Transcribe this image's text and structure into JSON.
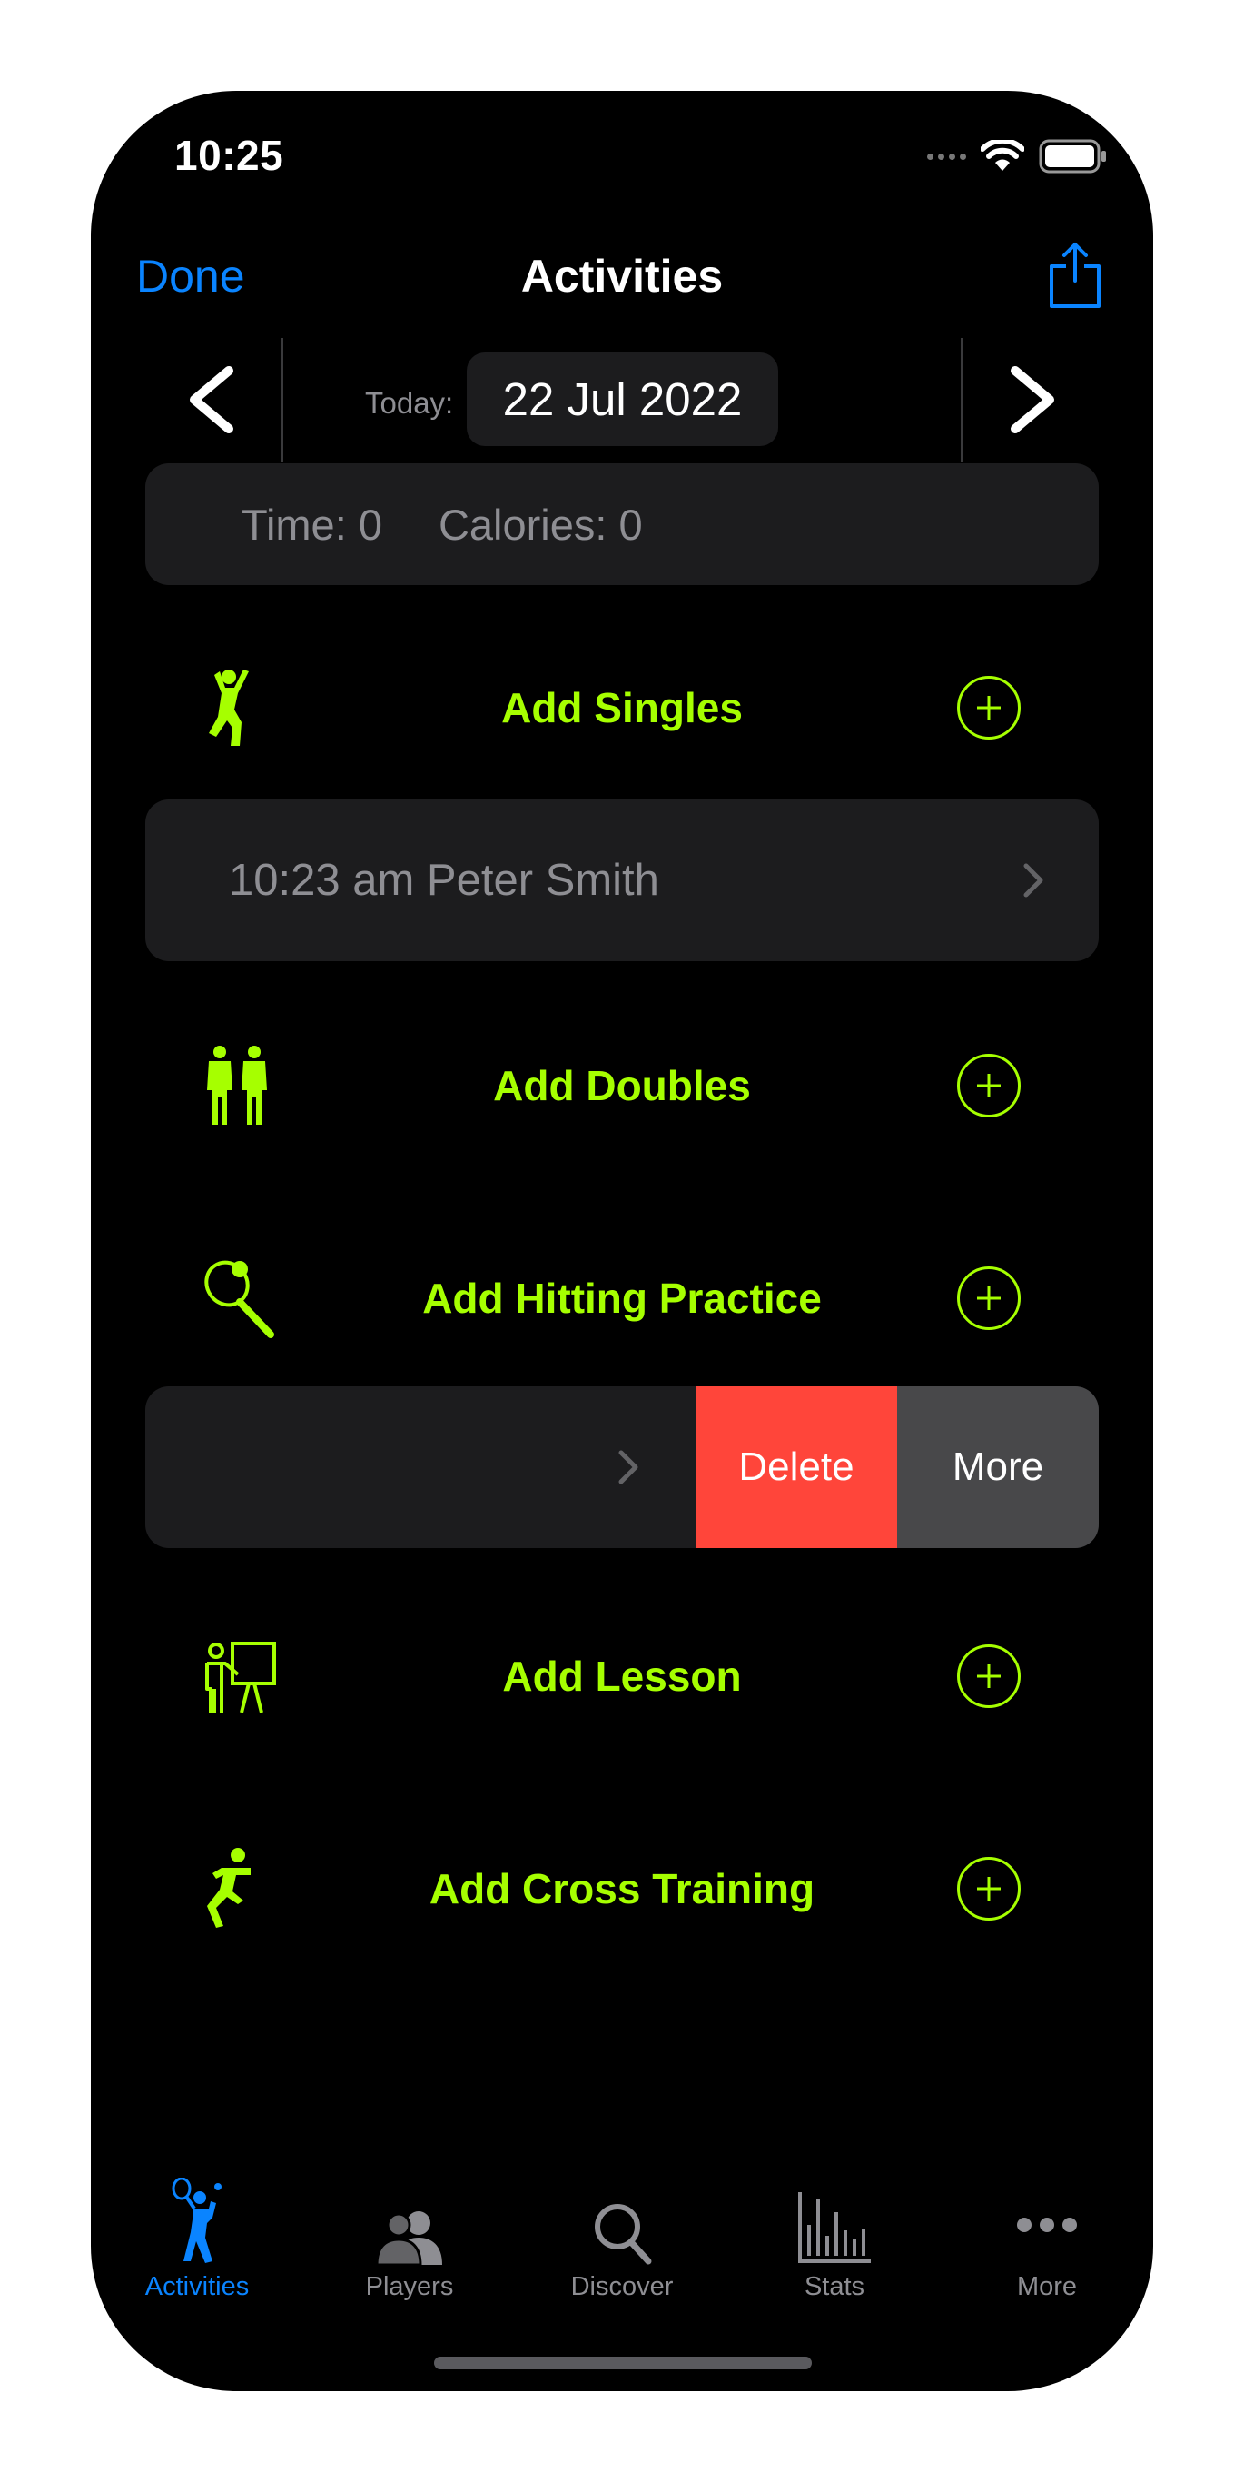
{
  "status_bar": {
    "time": "10:25"
  },
  "nav": {
    "done_label": "Done",
    "title": "Activities"
  },
  "date_selector": {
    "today_label": "Today:",
    "date": "22 Jul 2022"
  },
  "summary": {
    "time": "Time: 0",
    "calories": "Calories: 0"
  },
  "activities": [
    {
      "label": "Add Singles",
      "icon": "singles-player-icon"
    },
    {
      "label": "Add Doubles",
      "icon": "doubles-players-icon"
    },
    {
      "label": "Add Hitting Practice",
      "icon": "tennis-racket-icon"
    },
    {
      "label": "Add Lesson",
      "icon": "lesson-board-icon"
    },
    {
      "label": "Add Cross Training",
      "icon": "running-figure-icon"
    }
  ],
  "entries": [
    {
      "text": "10:23 am Peter Smith"
    }
  ],
  "swipe_actions": {
    "delete_label": "Delete",
    "more_label": "More"
  },
  "tabs": [
    {
      "label": "Activities",
      "icon": "tennis-player-icon",
      "active": true
    },
    {
      "label": "Players",
      "icon": "people-icon",
      "active": false
    },
    {
      "label": "Discover",
      "icon": "magnifier-icon",
      "active": false
    },
    {
      "label": "Stats",
      "icon": "bar-chart-icon",
      "active": false
    },
    {
      "label": "More",
      "icon": "ellipsis-icon",
      "active": false
    }
  ],
  "colors": {
    "accent": "#a6ff00",
    "tint": "#0a84ff",
    "delete": "#ff453a",
    "card": "#1c1c1e",
    "secondary_text": "#8e8e93"
  }
}
